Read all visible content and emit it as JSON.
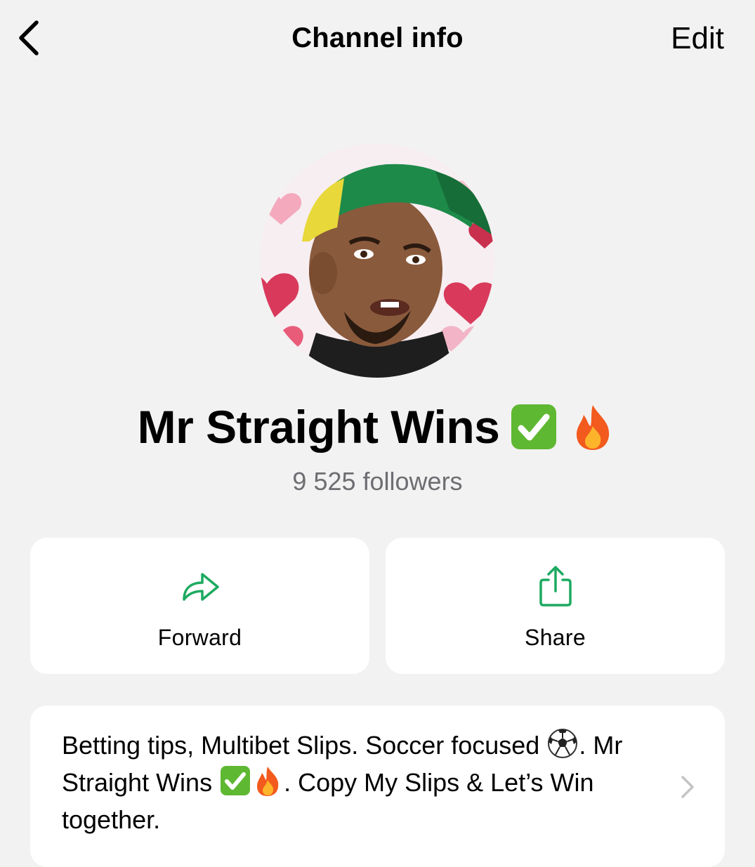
{
  "header": {
    "title": "Channel info",
    "edit_label": "Edit"
  },
  "channel": {
    "name": "Mr Straight Wins",
    "followers": "9 525 followers"
  },
  "actions": [
    {
      "label": "Forward",
      "icon": "forward-arrow-icon"
    },
    {
      "label": "Share",
      "icon": "share-icon"
    }
  ],
  "description": {
    "part1": "Betting tips, Multibet Slips. Soccer focused ",
    "part2": ". Mr Straight Wins ",
    "part3": ". Copy My Slips & Let’s Win together."
  },
  "colors": {
    "background": "#f2f2f2",
    "card": "#ffffff",
    "accent_green": "#1daa61",
    "secondary_text": "#6d6d72"
  }
}
